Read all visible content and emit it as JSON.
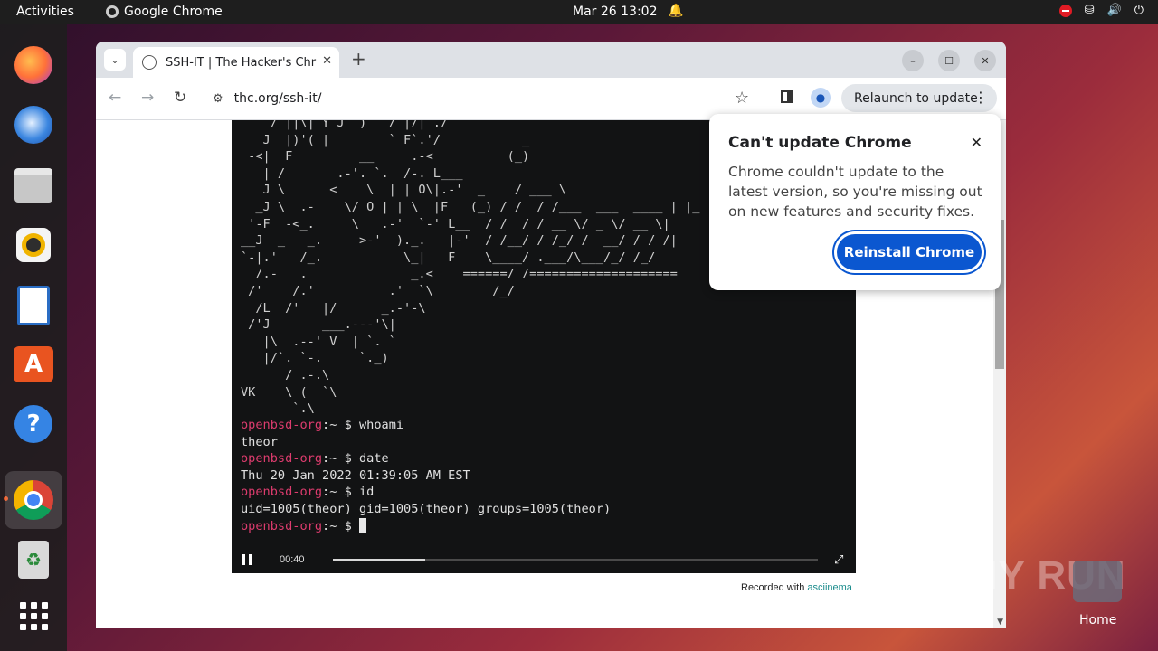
{
  "topbar": {
    "activities": "Activities",
    "app_name": "Google Chrome",
    "clock": "Mar 26  13:02"
  },
  "dock": {
    "items": [
      "firefox-icon",
      "thunderbird-icon",
      "files-icon",
      "rhythmbox-icon",
      "writer-icon",
      "app-center-icon",
      "help-icon",
      "chrome-icon",
      "trash-icon",
      "show-apps-icon"
    ]
  },
  "browser": {
    "tab_title": "SSH-IT | The Hacker's Chr",
    "url": "thc.org/ssh-it/",
    "relaunch_label": "Relaunch to update"
  },
  "terminal": {
    "art": "    / ||\\| Y J  )   / |/| ./\n   J  |)'( |        ` F`.'/           _\n -<|  F         __     .-<          (_)\n   | /       .-'. `.  /-. L___\n   J \\      <    \\  | | O\\|.-'  _    / ___ \\\n  _J \\  .-    \\/ O | | \\  |F   (_) / /  / /___  ___  ____ | |_\n '-F  -<_.     \\   .-'  `-' L__  / /  / / __ \\/ _ \\/ __ \\|\n__J  _   _.     >-'  )._.   |-'  / /__/ / /_/ /  __/ / / /|\n`-|.'   /_.           \\_|   F    \\____/ .___/\\___/_/ /_/\n  /.-   .              _.<    ======/ /====================\n /'    /.'          .'  `\\        /_/\n  /L  /'   |/      _.-'-\\\n /'J       ___.---'\\|\n   |\\  .--' V  | `. `\n   |/`. `-.     `._)\n      / .-.\\\nVK    \\ (  `\\\n       `.\\",
    "lines": [
      {
        "host": "openbsd-org",
        "prompt": ":~ $ ",
        "cmd": "whoami"
      },
      {
        "output": "theor"
      },
      {
        "host": "openbsd-org",
        "prompt": ":~ $ ",
        "cmd": "date"
      },
      {
        "output": "Thu 20 Jan 2022 01:39:05 AM EST"
      },
      {
        "host": "openbsd-org",
        "prompt": ":~ $ ",
        "cmd": "id"
      },
      {
        "output": "uid=1005(theor) gid=1005(theor) groups=1005(theor)"
      },
      {
        "host": "openbsd-org",
        "prompt": ":~ $ ",
        "cmd": ""
      }
    ],
    "player": {
      "time": "00:40",
      "progress": 0.19
    },
    "recorded_with": "Recorded with",
    "recorded_brand": "asciinema"
  },
  "popup": {
    "title": "Can't update Chrome",
    "body": "Chrome couldn't update to the latest version, so you're missing out on new features and security fixes.",
    "button": "Reinstall Chrome"
  },
  "watermark": "ANY RUN",
  "home_label": "Home"
}
